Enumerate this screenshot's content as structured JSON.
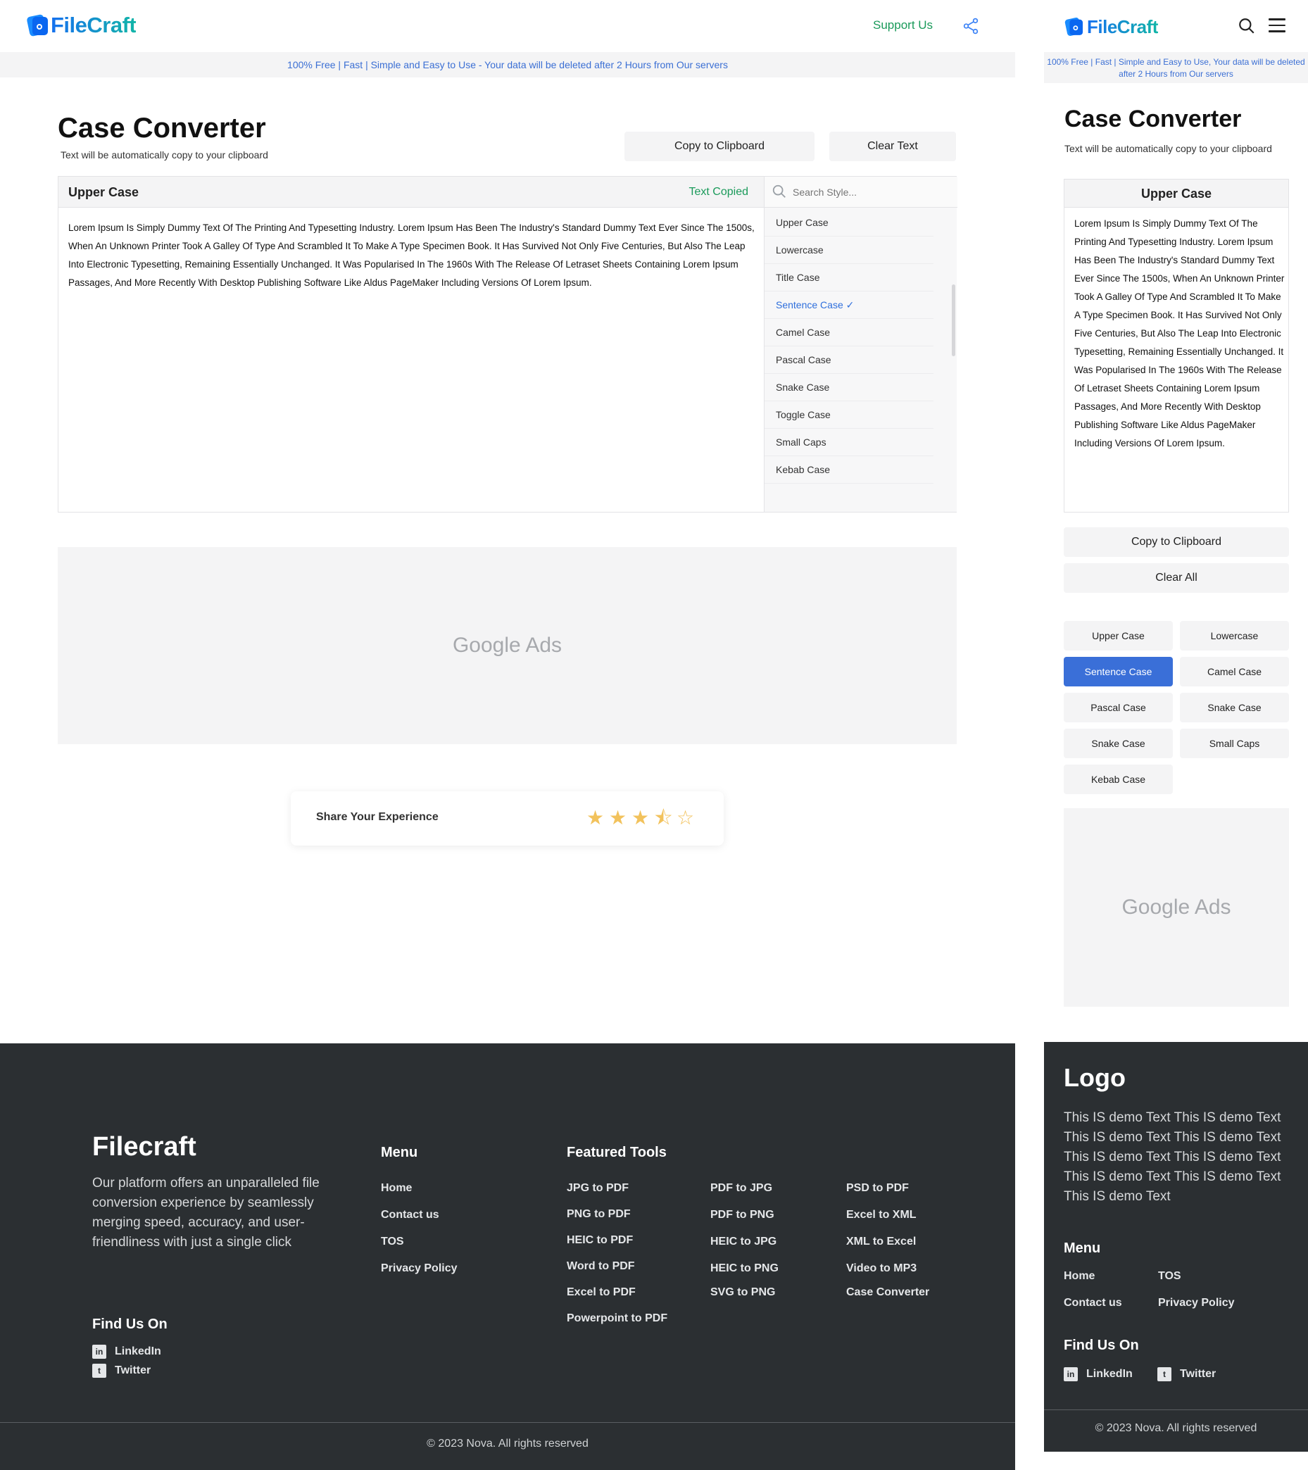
{
  "brand": {
    "name": "FileCraft"
  },
  "header": {
    "support_label": "Support Us"
  },
  "banner": {
    "desktop": "100% Free | Fast | Simple and Easy to Use -  Your data will be deleted after 2 Hours from Our servers",
    "mobile": "100% Free | Fast | Simple and Easy to Use, Your data will be deleted after 2 Hours from Our servers"
  },
  "page": {
    "title": "Case Converter",
    "subtitle": "Text will be automatically copy to your clipboard"
  },
  "buttons": {
    "copy": "Copy to Clipboard",
    "clear_desktop": "Clear Text",
    "clear_mobile": "Clear All"
  },
  "editor": {
    "label": "Upper Case",
    "status": "Text Copied",
    "text": "Lorem Ipsum Is Simply Dummy Text Of The Printing And Typesetting Industry. Lorem Ipsum Has Been The Industry's Standard Dummy Text Ever Since The 1500s, When An Unknown Printer Took A Galley Of Type And Scrambled It To Make A Type Specimen Book. It Has Survived Not Only Five Centuries, But Also The Leap Into Electronic Typesetting, Remaining Essentially Unchanged. It Was Popularised In The 1960s With The Release Of Letraset Sheets Containing Lorem Ipsum Passages, And More Recently With Desktop Publishing Software Like Aldus PageMaker Including Versions Of Lorem Ipsum."
  },
  "style_search": {
    "placeholder": "Search Style..."
  },
  "styles": [
    {
      "label": "Upper Case"
    },
    {
      "label": "Lowercase"
    },
    {
      "label": "Title Case"
    },
    {
      "label": "Sentence Case ✓",
      "active": true
    },
    {
      "label": "Camel Case"
    },
    {
      "label": "Pascal Case"
    },
    {
      "label": "Snake Case"
    },
    {
      "label": "Toggle Case"
    },
    {
      "label": "Small Caps"
    },
    {
      "label": "Kebab Case"
    }
  ],
  "mobile_chips": [
    {
      "label": "Upper Case"
    },
    {
      "label": "Lowercase"
    },
    {
      "label": "Sentence Case",
      "active": true
    },
    {
      "label": "Camel Case"
    },
    {
      "label": "Pascal Case"
    },
    {
      "label": "Snake Case"
    },
    {
      "label": "Snake Case"
    },
    {
      "label": "Small Caps"
    },
    {
      "label": "Kebab Case"
    }
  ],
  "ads": {
    "label": "Google Ads"
  },
  "rating": {
    "label": "Share Your Experience",
    "value": 3.5,
    "max": 5
  },
  "footer": {
    "brand": "Filecraft",
    "about": "Our platform offers an unparalleled file conversion experience by seamlessly merging speed, accuracy, and user-friendliness with just a single click",
    "menu_title": "Menu",
    "menu": [
      "Home",
      "Contact us",
      "TOS",
      "Privacy Policy"
    ],
    "tools_title": "Featured Tools",
    "tools_col1": [
      "JPG to PDF",
      "PNG to PDF",
      "HEIC to PDF",
      "Word to PDF",
      "Excel to PDF",
      "Powerpoint to PDF"
    ],
    "tools_col2": [
      "PDF to JPG",
      "PDF to PNG",
      "HEIC to JPG",
      "HEIC to PNG",
      "SVG to PNG"
    ],
    "tools_col3": [
      "PSD to PDF",
      "Excel to XML",
      "XML to Excel",
      "Video to MP3",
      "Case Converter"
    ],
    "find_title": "Find Us On",
    "social": [
      "LinkedIn",
      "Twitter"
    ],
    "copyright": "© 2023 Nova. All rights reserved"
  },
  "mobile_footer": {
    "logo": "Logo",
    "about": "This IS demo Text This IS demo Text This IS demo Text This IS demo Text This IS demo Text This IS demo Text This IS demo Text This IS demo Text This IS demo Text"
  },
  "colors": {
    "accent_blue": "#2f6fdc",
    "success_green": "#1a9a5a",
    "footer_bg": "#2b2f32",
    "star": "#f2c25c"
  }
}
